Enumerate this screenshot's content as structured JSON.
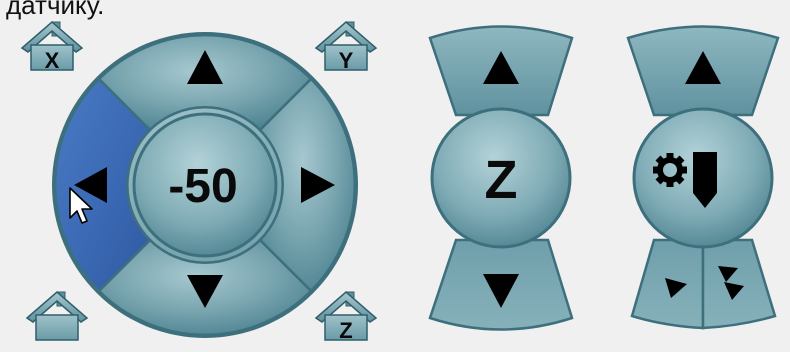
{
  "top_fragment": "датчику.",
  "xy_pad": {
    "center_step": "-50",
    "home_x_label": "X",
    "home_y_label": "Y",
    "home_z_label": "Z",
    "home_all_label": ""
  },
  "z_pad": {
    "center_label": "Z"
  },
  "probe_pad": {
    "center_icon": "probe-gear-icon"
  },
  "colors": {
    "pad_fill": "#7aa6b0",
    "pad_dark": "#3d6f7d",
    "active_segment": "#3f6db8",
    "background": "#f0f0f0"
  },
  "state": {
    "hovered_segment": "x-minus"
  }
}
